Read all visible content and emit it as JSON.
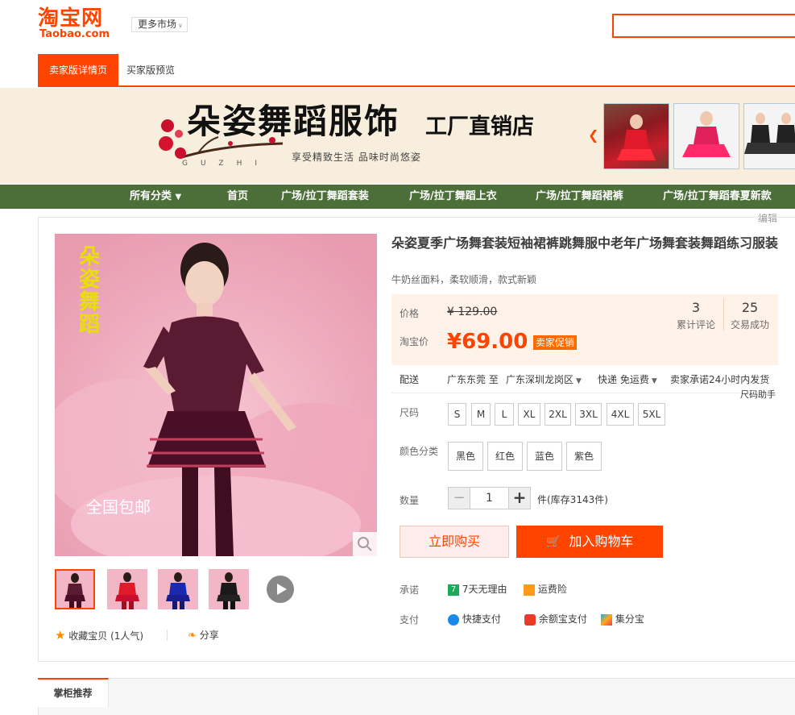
{
  "header": {
    "logo_cn": "淘宝网",
    "logo_en": "Taobao.com",
    "more_market": "更多市场"
  },
  "tabs": {
    "seller_detail": "卖家版详情页",
    "buyer_preview": "买家版预览"
  },
  "banner": {
    "brand": "朵姿舞蹈服饰",
    "factory": "工厂直销店",
    "slogan": "享受精致生活  品味时尚悠姿",
    "logo_letters": "GUZHI"
  },
  "nav": {
    "items": [
      "所有分类",
      "首页",
      "广场/拉丁舞蹈套装",
      "广场/拉丁舞蹈上衣",
      "广场/拉丁舞蹈裙裤",
      "广场/拉丁舞蹈春夏新款"
    ]
  },
  "edit_link": "编辑",
  "product": {
    "title": "朵姿夏季广场舞套装短袖裙裤跳舞服中老年广场舞套装舞蹈练习服装",
    "subtitle": "牛奶丝面料，柔软顺滑，款式新颖",
    "image_text_vertical": "朵姿舞蹈",
    "image_text_shipping": "全国包邮",
    "price_label": "价格",
    "old_price": "¥ 129.00",
    "taobao_price_label": "淘宝价",
    "new_price": "¥69.00",
    "promo_badge": "卖家促销",
    "reviews_count": "3",
    "reviews_label": "累计评论",
    "sales_count": "25",
    "sales_label": "交易成功",
    "shipping_label": "配送",
    "ship_from": "广东东莞 至",
    "ship_to": "广东深圳龙岗区",
    "express": "快递 免运费",
    "ship_promise": "卖家承诺24小时内发货",
    "size_guide": "尺码助手",
    "size_label": "尺码",
    "sizes": [
      "S",
      "M",
      "L",
      "XL",
      "2XL",
      "3XL",
      "4XL",
      "5XL"
    ],
    "color_label": "颜色分类",
    "colors": [
      "黑色",
      "红色",
      "蓝色",
      "紫色"
    ],
    "qty_label": "数量",
    "qty_value": "1",
    "qty_minus": "−",
    "qty_plus": "+",
    "stock": "件(库存3143件)",
    "buy_now": "立即购买",
    "add_to_cart": "加入购物车",
    "promise_label": "承诺",
    "promise_1": "7天无理由",
    "promise_2": "运费险",
    "pay_label": "支付",
    "pay_1": "快捷支付",
    "pay_2": "余额宝支付",
    "pay_3": "集分宝",
    "favorite": "收藏宝贝 (1人气)",
    "share": "分享",
    "icon_names": [
      "search-icon",
      "cart-icon",
      "star-icon",
      "share-icon",
      "play-icon"
    ]
  },
  "bottom": {
    "tab_recommend": "掌柜推荐"
  },
  "colors": {
    "accent": "#ff4400",
    "nav_bg": "#4c6e39",
    "banner_bg": "#f7eedd",
    "price_bg": "#fff2e8"
  }
}
